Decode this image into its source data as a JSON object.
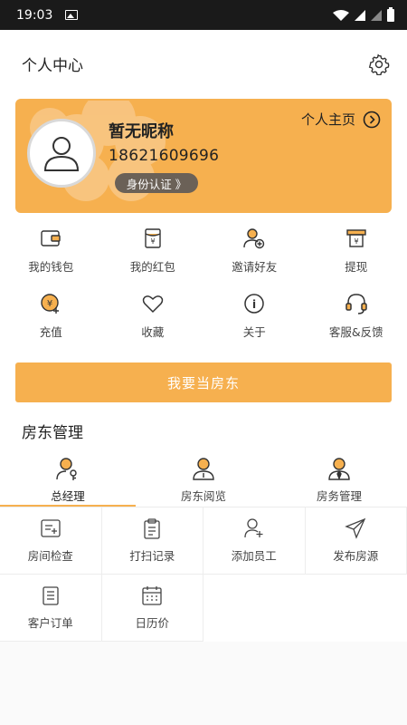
{
  "status_bar": {
    "time": "19:03"
  },
  "header": {
    "title": "个人中心"
  },
  "profile": {
    "nickname": "暂无昵称",
    "phone": "18621609696",
    "id_verify": "身份认证 》",
    "homepage_label": "个人主页"
  },
  "quick_actions": [
    {
      "label": "我的钱包",
      "icon": "wallet-icon"
    },
    {
      "label": "我的红包",
      "icon": "red-envelope-icon"
    },
    {
      "label": "邀请好友",
      "icon": "invite-friend-icon"
    },
    {
      "label": "提现",
      "icon": "withdraw-icon"
    },
    {
      "label": "充值",
      "icon": "recharge-icon"
    },
    {
      "label": "收藏",
      "icon": "heart-icon"
    },
    {
      "label": "关于",
      "icon": "info-icon"
    },
    {
      "label": "客服&反馈",
      "icon": "headset-icon"
    }
  ],
  "cta": {
    "label": "我要当房东"
  },
  "landlord": {
    "section_title": "房东管理",
    "roles": [
      {
        "label": "总经理",
        "icon": "manager-icon",
        "active": true
      },
      {
        "label": "房东阅览",
        "icon": "landlord-view-icon",
        "active": false
      },
      {
        "label": "房务管理",
        "icon": "housekeeping-icon",
        "active": false
      }
    ],
    "functions": [
      {
        "label": "房间检查",
        "icon": "room-check-icon"
      },
      {
        "label": "打扫记录",
        "icon": "clipboard-icon"
      },
      {
        "label": "添加员工",
        "icon": "add-staff-icon"
      },
      {
        "label": "发布房源",
        "icon": "send-icon"
      },
      {
        "label": "客户订单",
        "icon": "order-icon"
      },
      {
        "label": "日历价",
        "icon": "calendar-icon"
      }
    ]
  },
  "colors": {
    "accent": "#f6b04f",
    "badge": "#6b6157"
  }
}
